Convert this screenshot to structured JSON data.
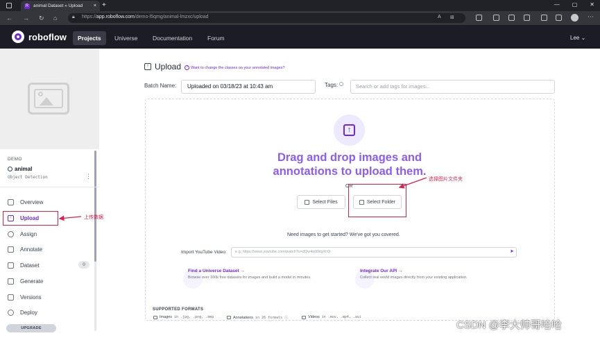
{
  "browser": {
    "tab_title": "animal Dataset » Upload",
    "tab_close": "×",
    "new_tab": "+",
    "window_controls": [
      "—",
      "▢",
      "✕"
    ],
    "url_prefix": "https://",
    "url_host": "app.roboflow.com",
    "url_path": "/demo-l5qmg/animal-lmzxc/upload"
  },
  "header": {
    "logo": "roboflow",
    "nav": [
      "Projects",
      "Universe",
      "Documentation",
      "Forum"
    ],
    "active_nav": "Projects",
    "user": "Lee",
    "user_caret": "⌄"
  },
  "sidebar": {
    "workspace": "DEMO",
    "project_name": "animal",
    "project_type": "Object Detection",
    "items": [
      {
        "label": "Overview",
        "icon": "overview-icon"
      },
      {
        "label": "Upload",
        "icon": "upload-icon",
        "active": true
      },
      {
        "label": "Assign",
        "icon": "assign-icon"
      },
      {
        "label": "Annotate",
        "icon": "annotate-icon"
      },
      {
        "label": "Dataset",
        "icon": "dataset-icon",
        "badge": "0"
      },
      {
        "label": "Generate",
        "icon": "generate-icon"
      },
      {
        "label": "Versions",
        "icon": "versions-icon"
      },
      {
        "label": "Deploy",
        "icon": "deploy-icon"
      }
    ],
    "upgrade": "UPGRADE"
  },
  "main": {
    "title": "Upload",
    "help_link": "Want to change the classes on your annotated images?",
    "batch_label": "Batch Name:",
    "batch_value": "Uploaded on 03/18/23 at 10:43 am",
    "tags_label": "Tags:",
    "tags_placeholder": "Search or add tags for images...",
    "drag_text": "Drag and drop images and annotations to upload them.",
    "or": "OR",
    "select_files": "Select Files",
    "select_folder": "Select Folder",
    "get_started": "Need images to get started? We've got you covered.",
    "youtube_label": "Import YouTube Video:",
    "youtube_placeholder": "e.g. https://www.youtube.com/watch?v=dQw4w9WgXcQ",
    "youtube_go": "➤",
    "cards": [
      {
        "title": "Find a Universe Dataset",
        "arrow": "→",
        "desc": "Browse over 100k free datasets for images and build a model in minutes."
      },
      {
        "title": "Integrate Our API",
        "arrow": "→",
        "desc": "Collect real world images directly from your existing application."
      }
    ],
    "formats_title": "SUPPORTED FORMATS",
    "formats": [
      {
        "label": "Images",
        "detail": "in .jpg, .png, .bmp"
      },
      {
        "label": "Annotations",
        "detail": "in 26 formats ⓘ"
      },
      {
        "label": "Videos",
        "detail": "in .mov, .mp4, .avi"
      }
    ]
  },
  "annotations": {
    "upload_note": "上传数据",
    "folder_note": "选择图片文件夹",
    "color": "#e11d48"
  },
  "watermark": "CSDN @李大帅哥哈哈"
}
